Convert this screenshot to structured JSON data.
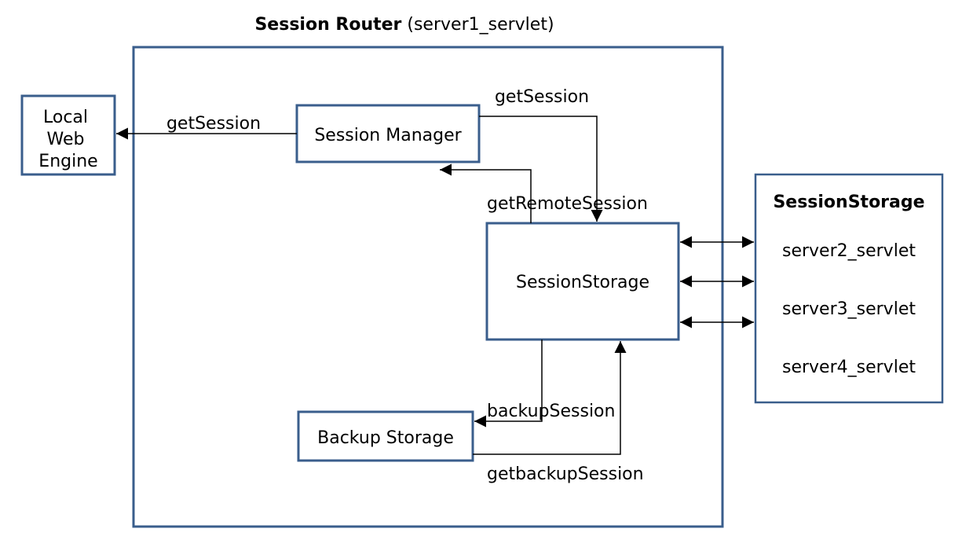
{
  "title": {
    "bold": "Session Router",
    "normal": " (server1_servlet)"
  },
  "localWebEngine": {
    "line1": "Local",
    "line2": "Web",
    "line3": "Engine"
  },
  "sessionManager": "Session Manager",
  "sessionStorageInner": "SessionStorage",
  "backupStorage": "Backup Storage",
  "sessionStorageOuter": {
    "title": "SessionStorage",
    "items": [
      "server2_servlet",
      "server3_servlet",
      "server4_servlet"
    ]
  },
  "edges": {
    "getSession_left": "getSession",
    "getSession_right": "getSession",
    "getRemoteSession": "getRemoteSession",
    "backupSession": "backupSession",
    "getBackupSession": "getbackupSession"
  }
}
